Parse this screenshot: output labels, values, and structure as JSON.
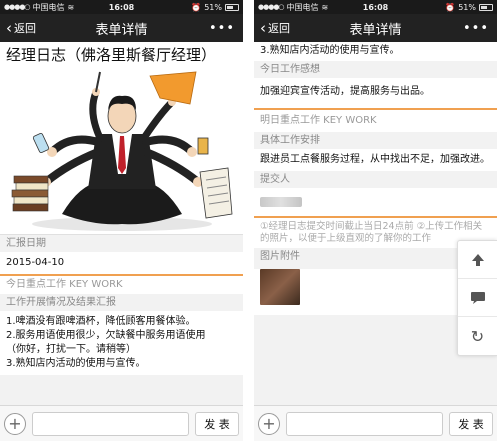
{
  "status_bar": {
    "carrier": "中国电信",
    "time": "16:08",
    "battery": "51%"
  },
  "nav": {
    "back_label": "返回",
    "title": "表单详情",
    "more_label": "•••"
  },
  "left": {
    "report_title": "经理日志（佛洛里斯餐厅经理）",
    "report_date_label": "汇报日期",
    "report_date_value": "2015-04-10",
    "key_work_label": "今日重点工作 KEY WORK",
    "progress_label": "工作开展情况及结果汇报",
    "progress_lines": [
      "1.啤酒没有跟啤酒杯，降低顾客用餐体验。",
      "2.服务用语使用很少，欠缺餐中服务用语使用",
      "（你好，打扰一下。请稍等）",
      "3.熟知店内活动的使用与宣传。"
    ]
  },
  "right": {
    "top_line": "3.熟知店内活动的使用与宣传。",
    "today_feeling_label": "今日工作感想",
    "today_feeling_value": "加强迎宾宣传活动，提高服务与出品。",
    "tomorrow_label": "明日重点工作 KEY WORK",
    "plan_label": "具体工作安排",
    "plan_value": "跟进员工点餐服务过程，从中找出不足，加强改进。",
    "submitter_label": "提交人",
    "note": "①经理日志提交时间截止当日24点前 ②上传工作相关的照片，以便于上级直观的了解你的工作",
    "attachment_label": "图片附件"
  },
  "bottom_bar": {
    "send_label": "发 表"
  },
  "float_buttons": {
    "up": "↑",
    "comment": "comment",
    "refresh": "↻"
  },
  "colors": {
    "nav_bg": "#222222",
    "accent_orange": "#f0a050",
    "page_bg": "#f2f2f2"
  }
}
